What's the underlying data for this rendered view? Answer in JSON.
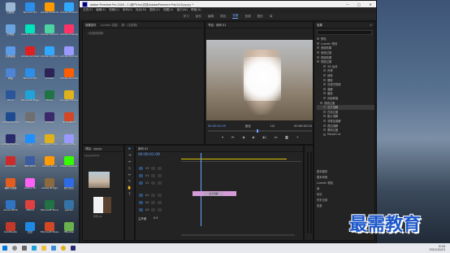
{
  "desktop": {
    "icons": [
      {
        "label": "回收站",
        "color": "#9bb7d4"
      },
      {
        "label": "Tencent QQ",
        "color": "#2b8ee8"
      },
      {
        "label": "Adobe Illustrator",
        "color": "#ff9a00"
      },
      {
        "label": "Adobe Photoshop",
        "color": "#31a8ff"
      },
      {
        "label": "此电脑",
        "color": "#6aa3e0"
      },
      {
        "label": "Adobe Audition",
        "color": "#00e4bb"
      },
      {
        "label": "Adobe Dreamwea",
        "color": "#4cd3a4"
      },
      {
        "label": "Adobe InDesign",
        "color": "#ff3366"
      },
      {
        "label": "控制面板",
        "color": "#5a9ae6"
      },
      {
        "label": "Adobe Acrobat",
        "color": "#e02020"
      },
      {
        "label": "Adobe Lightroom",
        "color": "#31a8ff"
      },
      {
        "label": "Adobe Premiere",
        "color": "#9999ff"
      },
      {
        "label": "网络",
        "color": "#4d84d6"
      },
      {
        "label": "Tencent QQ",
        "color": "#2b8ee8"
      },
      {
        "label": "eclipse",
        "color": "#2c2255"
      },
      {
        "label": "Adobe Animate",
        "color": "#ff5d00"
      },
      {
        "label": "Word",
        "color": "#2b579a"
      },
      {
        "label": "Microsoft Edge",
        "color": "#1fa3d8"
      },
      {
        "label": "Excel",
        "color": "#217346"
      },
      {
        "label": "Google Chrome",
        "color": "#e0b11a"
      },
      {
        "label": "Adobe Photos",
        "color": "#1e4b8f"
      },
      {
        "label": "VMware",
        "color": "#6f6f6f"
      },
      {
        "label": "eclipse",
        "color": "#3a2a6a"
      },
      {
        "label": "PowerPoint",
        "color": "#d24726"
      },
      {
        "label": "Adobe Premiere",
        "color": "#2a2a6a"
      },
      {
        "label": "钉钉",
        "color": "#1e90ff"
      },
      {
        "label": "Google Chrome",
        "color": "#e0b11a"
      },
      {
        "label": "Adobe After",
        "color": "#9999ff"
      },
      {
        "label": "AutoCAD",
        "color": "#cc2b2b"
      },
      {
        "label": "IBM SPSS",
        "color": "#3b5ca0"
      },
      {
        "label": "Adobe Illust",
        "color": "#ff9a00"
      },
      {
        "label": "Dreamweaver",
        "color": "#35fa00"
      },
      {
        "label": "福昕阅读器",
        "color": "#e45d20"
      },
      {
        "label": "Adobe XD",
        "color": "#ff61f6"
      },
      {
        "label": "Adobe Bridge",
        "color": "#8c6a3f"
      },
      {
        "label": "腾讯会议",
        "color": "#2e6be6"
      },
      {
        "label": "Azure RTOS",
        "color": "#2f74c0"
      },
      {
        "label": "XMind",
        "color": "#e04040"
      },
      {
        "label": "Microsoft Excel",
        "color": "#217346"
      },
      {
        "label": "python",
        "color": "#3572a5"
      },
      {
        "label": "CamStudio",
        "color": "#c0392b"
      },
      {
        "label": "迅雷",
        "color": "#1e88e5"
      },
      {
        "label": "Microsoft PowerPoint",
        "color": "#d24726"
      },
      {
        "label": "HBuilder",
        "color": "#6ab04c"
      }
    ]
  },
  "app": {
    "title": "Adobe Premiere Pro 2020 - C:\\用户\\Hzy\\文档\\Adobe\\Premiere Pro\\14.0\\yyyyy *",
    "menu": [
      "文件(F)",
      "编辑(E)",
      "剪辑(C)",
      "序列(S)",
      "标记(M)",
      "图形(G)",
      "视图(V)",
      "窗口(W)",
      "帮助(H)"
    ],
    "workspaces": [
      "学习",
      "组件",
      "编辑",
      "颜色",
      "效果",
      "音频",
      "图形",
      "库"
    ],
    "active_workspace": "效果"
  },
  "left_panel": {
    "tabs": [
      "效果控件",
      "Lumetri 范围",
      "源：(无剪辑)"
    ],
    "source_text": "（未选择剪辑）"
  },
  "program": {
    "tab": "节目：序列 01",
    "timecode_left": "00:00:01:09",
    "fit": "适合",
    "ratio": "1/2",
    "timecode_right": "00:00:02:24"
  },
  "effects": {
    "title": "效果",
    "items": [
      "预设",
      "Lumetri 预设",
      "音频效果",
      "音频过渡",
      "视频效果",
      "视频过渡",
      "3D 运动",
      "内滑",
      "划像",
      "擦除",
      "沉浸式视频",
      "溶解",
      "缩放",
      "页面剥落",
      "视频过渡",
      "交叉溶解",
      "白场过渡",
      "胶片溶解",
      "非叠加溶解",
      "叠加溶解",
      "黑场过渡",
      "MorphCut"
    ],
    "extra": [
      "基本图形",
      "基本声音",
      "Lumetri 颜色",
      "库",
      "标记",
      "历史记录",
      "信息"
    ]
  },
  "project": {
    "tab": "项目：yyyyy",
    "items": [
      "yyyyy.prproj",
      "序列 01"
    ]
  },
  "timeline": {
    "tab": "序列 01",
    "timecode": "00:00:01:09",
    "tracks": [
      "V3",
      "V2",
      "V1",
      "A1",
      "A2",
      "A3"
    ],
    "clip_label": "交叉溶解",
    "master": "主声道",
    "master_value": "0.0"
  },
  "watermark": "最需教育",
  "tray": {
    "time": "8:34",
    "date": "2021/10/15"
  }
}
